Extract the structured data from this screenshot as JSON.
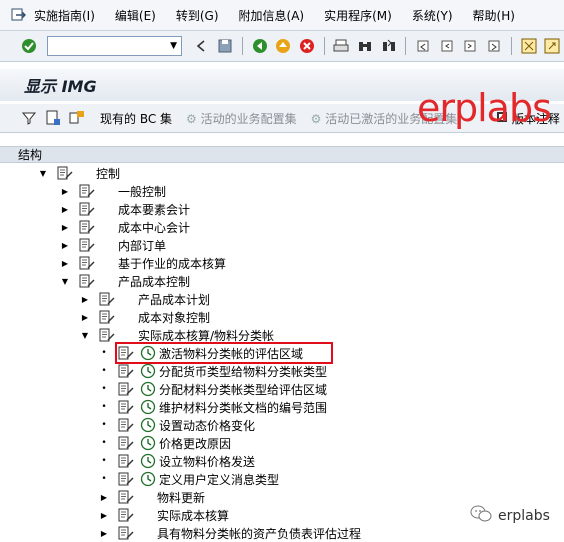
{
  "menubar": {
    "items": [
      "实施指南(I)",
      "编辑(E)",
      "转到(G)",
      "附加信息(A)",
      "实用程序(M)",
      "系统(Y)",
      "帮助(H)"
    ]
  },
  "toolbar": {
    "command_value": ""
  },
  "screen": {
    "title": "显示 IMG"
  },
  "app_toolbar": {
    "bc_sets": "现有的 BC 集",
    "active_bc": "活动的业务配置集",
    "activated_bc": "活动已激活的业务配置集",
    "release_notes": "版本注释"
  },
  "watermark": "erplabs",
  "structure_label": "结构",
  "tree": [
    {
      "label": "控制",
      "level": 0,
      "state": "open",
      "kind": "folder"
    },
    {
      "label": "一般控制",
      "level": 1,
      "state": "closed",
      "kind": "folder"
    },
    {
      "label": "成本要素会计",
      "level": 1,
      "state": "closed",
      "kind": "folder"
    },
    {
      "label": "成本中心会计",
      "level": 1,
      "state": "closed",
      "kind": "folder"
    },
    {
      "label": "内部订单",
      "level": 1,
      "state": "closed",
      "kind": "folder"
    },
    {
      "label": "基于作业的成本核算",
      "level": 1,
      "state": "closed",
      "kind": "folder"
    },
    {
      "label": "产品成本控制",
      "level": 1,
      "state": "open",
      "kind": "folder"
    },
    {
      "label": "产品成本计划",
      "level": 2,
      "state": "closed",
      "kind": "folder"
    },
    {
      "label": "成本对象控制",
      "level": 2,
      "state": "closed",
      "kind": "folder"
    },
    {
      "label": "实际成本核算/物料分类帐",
      "level": 2,
      "state": "open",
      "kind": "folder"
    },
    {
      "label": "激活物料分类帐的评估区域",
      "level": 3,
      "state": "leaf",
      "kind": "activity"
    },
    {
      "label": "分配货币类型给物料分类帐类型",
      "level": 3,
      "state": "leaf",
      "kind": "activity"
    },
    {
      "label": "分配材料分类帐类型给评估区域",
      "level": 3,
      "state": "leaf",
      "kind": "activity"
    },
    {
      "label": "维护材料分类帐文档的编号范围",
      "level": 3,
      "state": "leaf",
      "kind": "activity"
    },
    {
      "label": "设置动态价格变化",
      "level": 3,
      "state": "leaf",
      "kind": "activity"
    },
    {
      "label": "价格更改原因",
      "level": 3,
      "state": "leaf",
      "kind": "activity"
    },
    {
      "label": "设立物料价格发送",
      "level": 3,
      "state": "leaf",
      "kind": "activity"
    },
    {
      "label": "定义用户定义消息类型",
      "level": 3,
      "state": "leaf",
      "kind": "activity"
    },
    {
      "label": "物料更新",
      "level": 3,
      "state": "closed",
      "kind": "folder"
    },
    {
      "label": "实际成本核算",
      "level": 3,
      "state": "closed",
      "kind": "folder"
    },
    {
      "label": "具有物料分类帐的资产负债表评估过程",
      "level": 3,
      "state": "closed",
      "kind": "folder"
    }
  ],
  "selected_item": "激活物料分类帐的评估区域",
  "footer_brand": "erplabs"
}
